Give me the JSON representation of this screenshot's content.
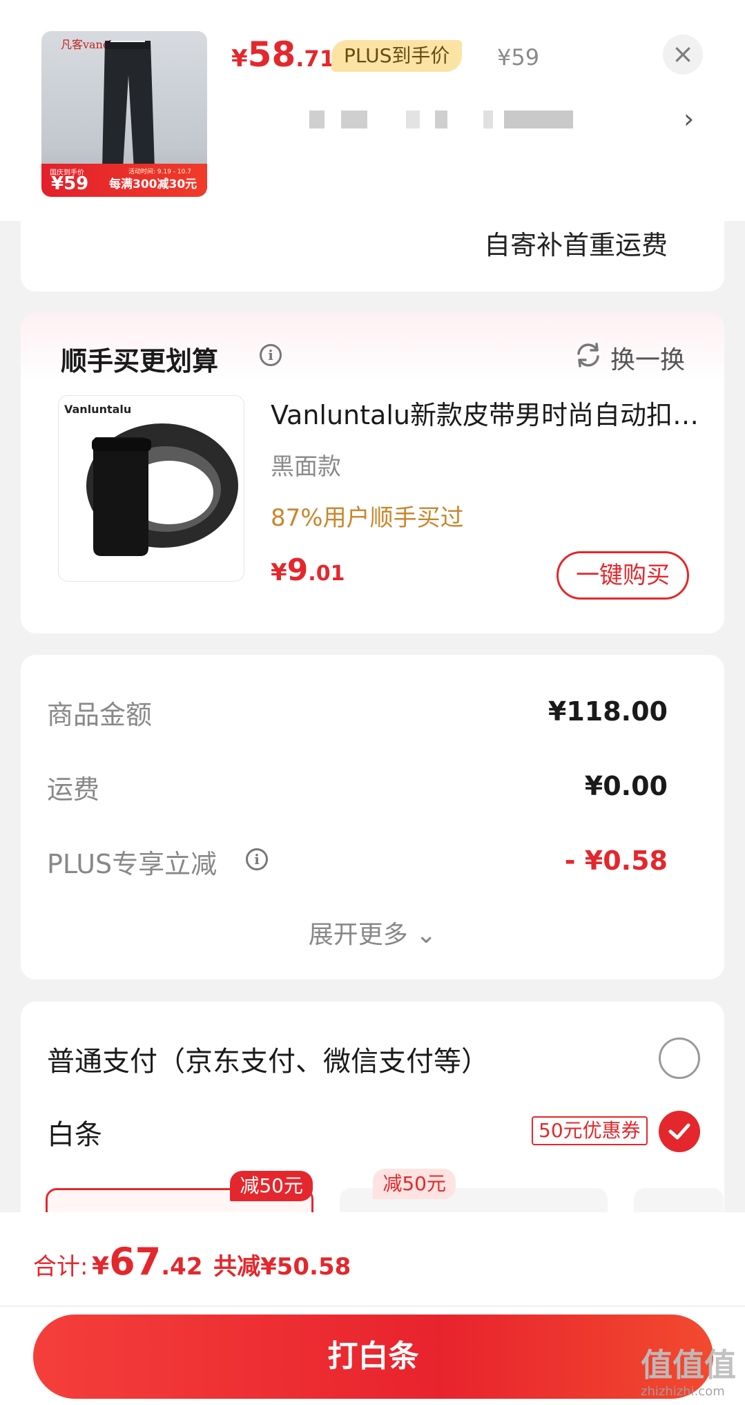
{
  "header": {
    "thumb_brand": "凡客vancl",
    "thumb_promo_small": "国庆到手价",
    "thumb_promo_date": "活动时间: 9.19 - 10.7",
    "thumb_promo_price": "¥59",
    "thumb_promo_text": "每满300减30元",
    "price_currency": "¥",
    "price_int": "58",
    "price_dec": ".71",
    "plus_tag": "PLUS到手价",
    "orig_price": "¥59",
    "close_icon": "×",
    "arrow": "›"
  },
  "shipping": {
    "text": "自寄补首重运费"
  },
  "addon": {
    "title": "顺手买更划算",
    "info_icon": "i",
    "swap_label": "换一换",
    "product_brand": "Vanluntalu",
    "product_name": "Vanluntalu新款皮带男时尚自动扣皮带",
    "variant": "黑面款",
    "social_proof": "87%用户顺手买过",
    "price_currency": "¥",
    "price_int": "9",
    "price_dec": ".01",
    "buy_button": "一键购买"
  },
  "summary": {
    "rows": [
      {
        "label": "商品金额",
        "value": "¥118.00"
      },
      {
        "label": "运费",
        "value": "¥0.00"
      },
      {
        "label": "PLUS专享立减",
        "value": "- ¥0.58"
      }
    ],
    "info_icon": "i",
    "expand": "展开更多 ⌄"
  },
  "payment": {
    "option_normal": "普通支付（京东支付、微信支付等）",
    "option_baitiao": "白条",
    "coupon": "50元优惠券",
    "installments": [
      {
        "badge": "减50元"
      },
      {
        "badge": "减50元"
      }
    ]
  },
  "bottom": {
    "total_label": "合计:",
    "total_currency": "¥",
    "total_int": "67",
    "total_dec": ".42",
    "total_saving": "共减¥50.58",
    "pay_button": "打白条"
  },
  "watermark": {
    "main": "值值值",
    "sub": "zhizhizhi.com"
  },
  "colors": {
    "accent": "#e4272c",
    "plus_tag_bg": "#fbe3a3",
    "social_proof": "#c9862c"
  }
}
